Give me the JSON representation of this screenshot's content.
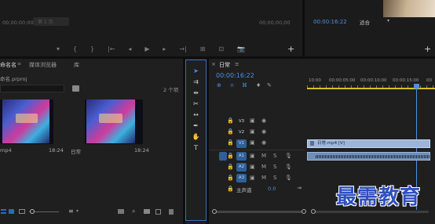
{
  "source_monitor": {
    "clip_name": "第 1 页",
    "timecode": "00;00;00;00",
    "duration": "00;00;00;00",
    "controls": [
      "▾",
      "{",
      "}",
      "|←",
      "◂",
      "▶",
      "▸",
      "→|",
      "⊞",
      "⊡",
      "📷"
    ],
    "add_button": "+"
  },
  "program_monitor": {
    "timecode": "00:00:16:22",
    "fit_label": "适合",
    "add_button": "+"
  },
  "project": {
    "tabs": [
      "命名名",
      "媒体浏览器",
      "库"
    ],
    "project_file": "命名.prproj",
    "item_count": "2 个项",
    "search_icon": "magnifier-icon",
    "items": [
      {
        "name": "mp4",
        "duration": "18:24"
      },
      {
        "name": "日常",
        "duration": "18:24"
      }
    ]
  },
  "tools": {
    "names": [
      "selection-tool",
      "track-select-tool",
      "ripple-edit-tool",
      "razor-tool",
      "slip-tool",
      "pen-tool",
      "hand-tool",
      "type-tool"
    ],
    "glyphs": [
      "➤",
      "⇉",
      "⇹",
      "✂",
      "↔",
      "✒",
      "✋",
      "T"
    ]
  },
  "timeline": {
    "close": "×",
    "sequence_name": "日常",
    "menu": "≡",
    "timecode": "00:00:16:22",
    "ruler_labels": [
      "10:00",
      "00:00:05:00",
      "00:00:10:00",
      "00:00:15:00",
      "00"
    ],
    "video_tracks": [
      "V3",
      "V2",
      "V1"
    ],
    "audio_tracks": [
      "A1",
      "A2",
      "A3"
    ],
    "master_label": "主声道",
    "master_value": "0.0",
    "mute_label": "M",
    "solo_label": "S",
    "video_clip_label": "日常.mp4 [V]"
  },
  "watermark": "最需教育",
  "colors": {
    "accent": "#4e8fe8",
    "playhead": "#4b8fe8",
    "video_clip": "#9db5d9",
    "track_active": "#2f5f99",
    "watermark": "#2f4fbf"
  }
}
